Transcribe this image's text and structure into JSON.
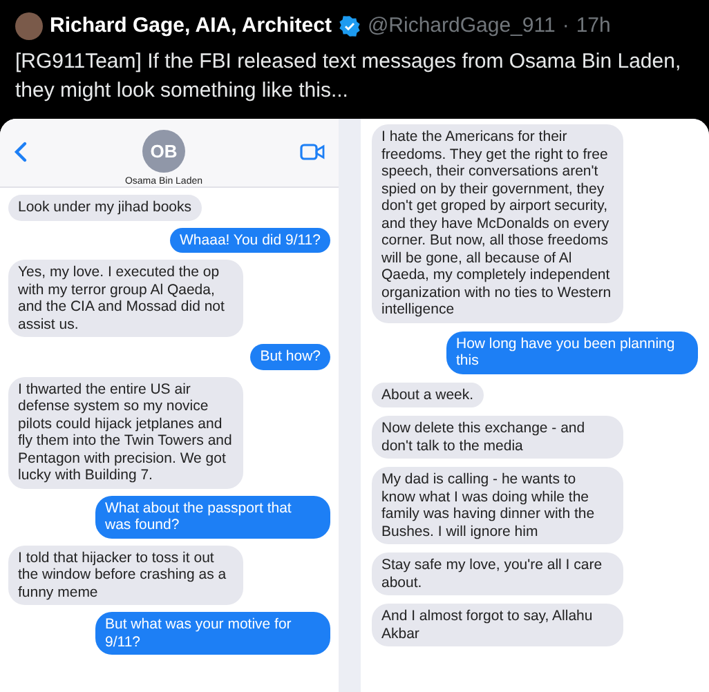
{
  "tweet": {
    "author": "Richard Gage, AIA, Architect",
    "verified": true,
    "handle": "@RichardGage_911",
    "separator": "·",
    "time": "17h",
    "text": "[RG911Team] If the FBI released text messages from Osama Bin Laden, they might look something like this..."
  },
  "left_panel": {
    "avatar_initials": "OB",
    "contact_name": "Osama Bin Laden",
    "messages": [
      {
        "kind": "received",
        "text": "Look under my jihad books"
      },
      {
        "kind": "sent",
        "text": "Whaaa! You did 9/11?"
      },
      {
        "kind": "received",
        "text": "Yes, my love. I executed the op with my terror group Al Qaeda, and the CIA and Mossad did not assist us."
      },
      {
        "kind": "sent",
        "text": "But how?"
      },
      {
        "kind": "received",
        "text": "I thwarted the entire US air defense system so my novice pilots could hijack jetplanes and fly them into the Twin Towers and Pentagon with precision. We got lucky with Building 7."
      },
      {
        "kind": "sent",
        "text": "What about the passport that was found?"
      },
      {
        "kind": "received",
        "text": "I told that hijacker to toss it out the window before crashing as a funny meme"
      },
      {
        "kind": "sent",
        "text": "But what was your motive for 9/11?"
      }
    ]
  },
  "right_panel": {
    "messages": [
      {
        "kind": "received",
        "text": "I hate the Americans for their freedoms. They get the right to free speech, their conversations aren't spied on by their government, they don't get groped by airport security, and they have McDonalds on every corner. But now, all those freedoms will be gone, all because of Al Qaeda, my completely independent organization with no ties to Western intelligence"
      },
      {
        "kind": "sent",
        "text": "How long have you been planning this"
      },
      {
        "kind": "received",
        "text": "About a week."
      },
      {
        "kind": "received",
        "text": "Now delete this exchange - and don't talk to the media"
      },
      {
        "kind": "received",
        "text": "My dad is calling - he wants to know what I was doing while the family was having dinner with the Bushes. I will ignore him"
      },
      {
        "kind": "received",
        "text": "Stay safe my love, you're all I care about."
      },
      {
        "kind": "received",
        "text": "And I almost forgot to say, Allahu Akbar"
      }
    ]
  }
}
